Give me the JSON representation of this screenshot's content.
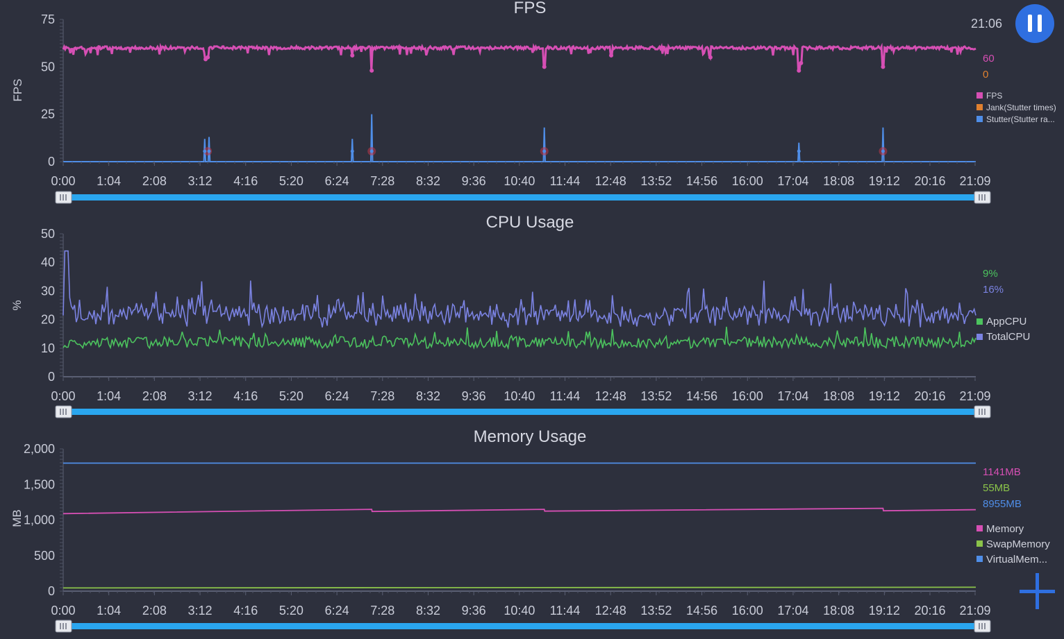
{
  "clock": "21:06",
  "icons": {
    "pause": "pause-icon",
    "add": "plus-icon"
  },
  "timeline": [
    "0:00",
    "1:04",
    "2:08",
    "3:12",
    "4:16",
    "5:20",
    "6:24",
    "7:28",
    "8:32",
    "9:36",
    "10:40",
    "11:44",
    "12:48",
    "13:52",
    "14:56",
    "16:00",
    "17:04",
    "18:08",
    "19:12",
    "20:16",
    "21:09"
  ],
  "chart_data": [
    {
      "type": "line",
      "title": "FPS",
      "ylabel": "FPS",
      "ylim": [
        0,
        75
      ],
      "yticks": [
        "0",
        "25",
        "50",
        "75"
      ],
      "x_range": [
        "0:00",
        "21:09"
      ],
      "current_values": [
        {
          "text": "60",
          "color": "#d64fb4"
        },
        {
          "text": "0",
          "color": "#e0802f"
        }
      ],
      "series": [
        {
          "name": "FPS",
          "color": "#d64fb4",
          "baseline": 60,
          "dips": [
            [
              3.3,
              54
            ],
            [
              3.35,
              55
            ],
            [
              6.7,
              56
            ],
            [
              7.15,
              48
            ],
            [
              11.15,
              50
            ],
            [
              12.7,
              56
            ],
            [
              15.0,
              55
            ],
            [
              17.05,
              48
            ],
            [
              17.1,
              52
            ],
            [
              19.0,
              50
            ]
          ]
        },
        {
          "name": "Jank(Stutter times)",
          "color": "#e0802f",
          "values": [
            0
          ]
        },
        {
          "name": "Stutter(Stutter ra...",
          "color": "#4f8ee8",
          "baseline": 0,
          "spikes": [
            [
              3.28,
              12
            ],
            [
              3.38,
              13
            ],
            [
              6.7,
              12
            ],
            [
              7.15,
              25
            ],
            [
              11.15,
              18
            ],
            [
              17.05,
              10
            ],
            [
              19.0,
              18
            ]
          ]
        }
      ],
      "stutter_markers": [
        3.35,
        7.15,
        11.15,
        19.0
      ]
    },
    {
      "type": "line",
      "title": "CPU Usage",
      "ylabel": "%",
      "ylim": [
        0,
        50
      ],
      "yticks": [
        "0",
        "10",
        "20",
        "30",
        "40",
        "50"
      ],
      "x_range": [
        "0:00",
        "21:09"
      ],
      "current_values": [
        {
          "text": "9%",
          "color": "#4cc35e"
        },
        {
          "text": "16%",
          "color": "#7b83e2"
        }
      ],
      "series": [
        {
          "name": "AppCPU",
          "color": "#4cc35e",
          "typical": 12,
          "range": [
            8,
            18
          ]
        },
        {
          "name": "TotalCPU",
          "color": "#7b83e2",
          "typical": 20,
          "range": [
            15,
            44
          ],
          "peak": [
            0.08,
            44
          ]
        }
      ]
    },
    {
      "type": "line",
      "title": "Memory Usage",
      "ylabel": "MB",
      "ylim": [
        0,
        2000
      ],
      "yticks": [
        "0",
        "500",
        "1,000",
        "1,500",
        "2,000"
      ],
      "x_range": [
        "0:00",
        "21:09"
      ],
      "current_values": [
        {
          "text": "1141MB",
          "color": "#d64fb4"
        },
        {
          "text": "55MB",
          "color": "#8bc34a"
        },
        {
          "text": "8955MB",
          "color": "#4f8ee8"
        }
      ],
      "series": [
        {
          "name": "Memory",
          "color": "#d64fb4",
          "x": [
            0,
            7.15,
            7.16,
            11.15,
            11.16,
            19.0,
            19.01,
            21.15
          ],
          "y": [
            1090,
            1150,
            1120,
            1150,
            1125,
            1165,
            1130,
            1145
          ]
        },
        {
          "name": "SwapMemory",
          "color": "#8bc34a",
          "x": [
            0,
            21.15
          ],
          "y": [
            45,
            55
          ]
        },
        {
          "name": "VirtualMem...",
          "color": "#4f8ee8",
          "x": [
            0,
            21.15
          ],
          "y": [
            1800,
            1800
          ]
        }
      ]
    }
  ]
}
